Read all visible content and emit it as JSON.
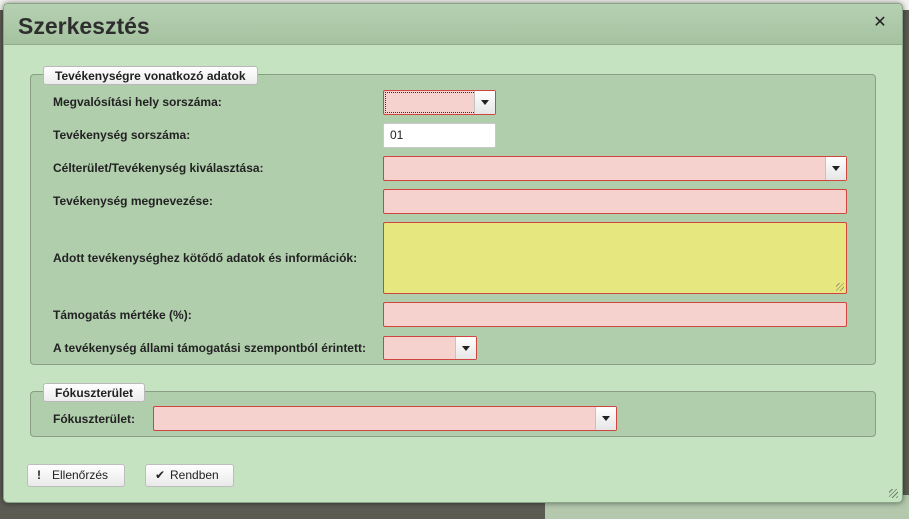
{
  "background": {
    "text_left": "",
    "text_right": ""
  },
  "dialog": {
    "title": "Szerkesztés",
    "close_icon": "close-icon"
  },
  "section_activity": {
    "legend": "Tevékenységre vonatkozó adatok",
    "fields": {
      "location_no_label": "Megvalósítási hely sorszáma:",
      "location_no_value": "",
      "activity_no_label": "Tevékenység sorszáma:",
      "activity_no_value": "01",
      "target_area_label": "Célterület/Tevékenység kiválasztása:",
      "target_area_value": "",
      "activity_name_label": "Tevékenység megnevezése:",
      "activity_name_value": "",
      "details_label": "Adott tevékenységhez kötődő adatok és információk:",
      "details_value": "",
      "support_rate_label": "Támogatás mértéke (%):",
      "support_rate_value": "",
      "state_aid_label": "A tevékenység állami támogatási szempontból érintett:",
      "state_aid_value": ""
    }
  },
  "section_focus": {
    "legend": "Fókuszterület",
    "focus_label": "Fókuszterület:",
    "focus_value": ""
  },
  "buttons": {
    "check_label": "Ellenőrzés",
    "check_icon": "exclamation-icon",
    "ok_label": "Rendben",
    "ok_icon": "checkmark-icon"
  },
  "colors": {
    "dialog_bg": "#c5e3c1",
    "fieldset_bg": "#b0ceac",
    "invalid_field_bg": "#f6d2cf",
    "invalid_border": "#d0453d",
    "textarea_bg": "#e7e77f"
  }
}
